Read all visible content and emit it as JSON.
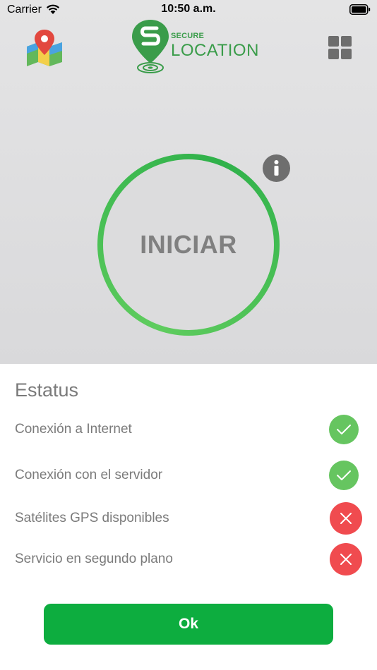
{
  "status_bar": {
    "carrier": "Carrier",
    "time": "10:50 a.m."
  },
  "header": {
    "map_icon": "map-pin-icon",
    "logo_small": "SECURE",
    "logo_large": "LOCATION",
    "menu_icon": "grid-icon"
  },
  "main": {
    "start_label": "INICIAR",
    "info_icon": "info-icon"
  },
  "status": {
    "title": "Estatus",
    "items": [
      {
        "label": "Conexión a Internet",
        "state": "ok"
      },
      {
        "label": "Conexión con el servidor",
        "state": "ok"
      },
      {
        "label": "Satélites GPS disponibles",
        "state": "fail"
      },
      {
        "label": "Servicio en segundo plano",
        "state": "fail"
      }
    ]
  },
  "footer": {
    "ok_label": "Ok"
  },
  "colors": {
    "brand_green": "#3a9c4a",
    "ring_green": "#2fb14a",
    "ok_green": "#66c560",
    "fail_red": "#f04b4f",
    "button_green": "#0dad3f"
  }
}
